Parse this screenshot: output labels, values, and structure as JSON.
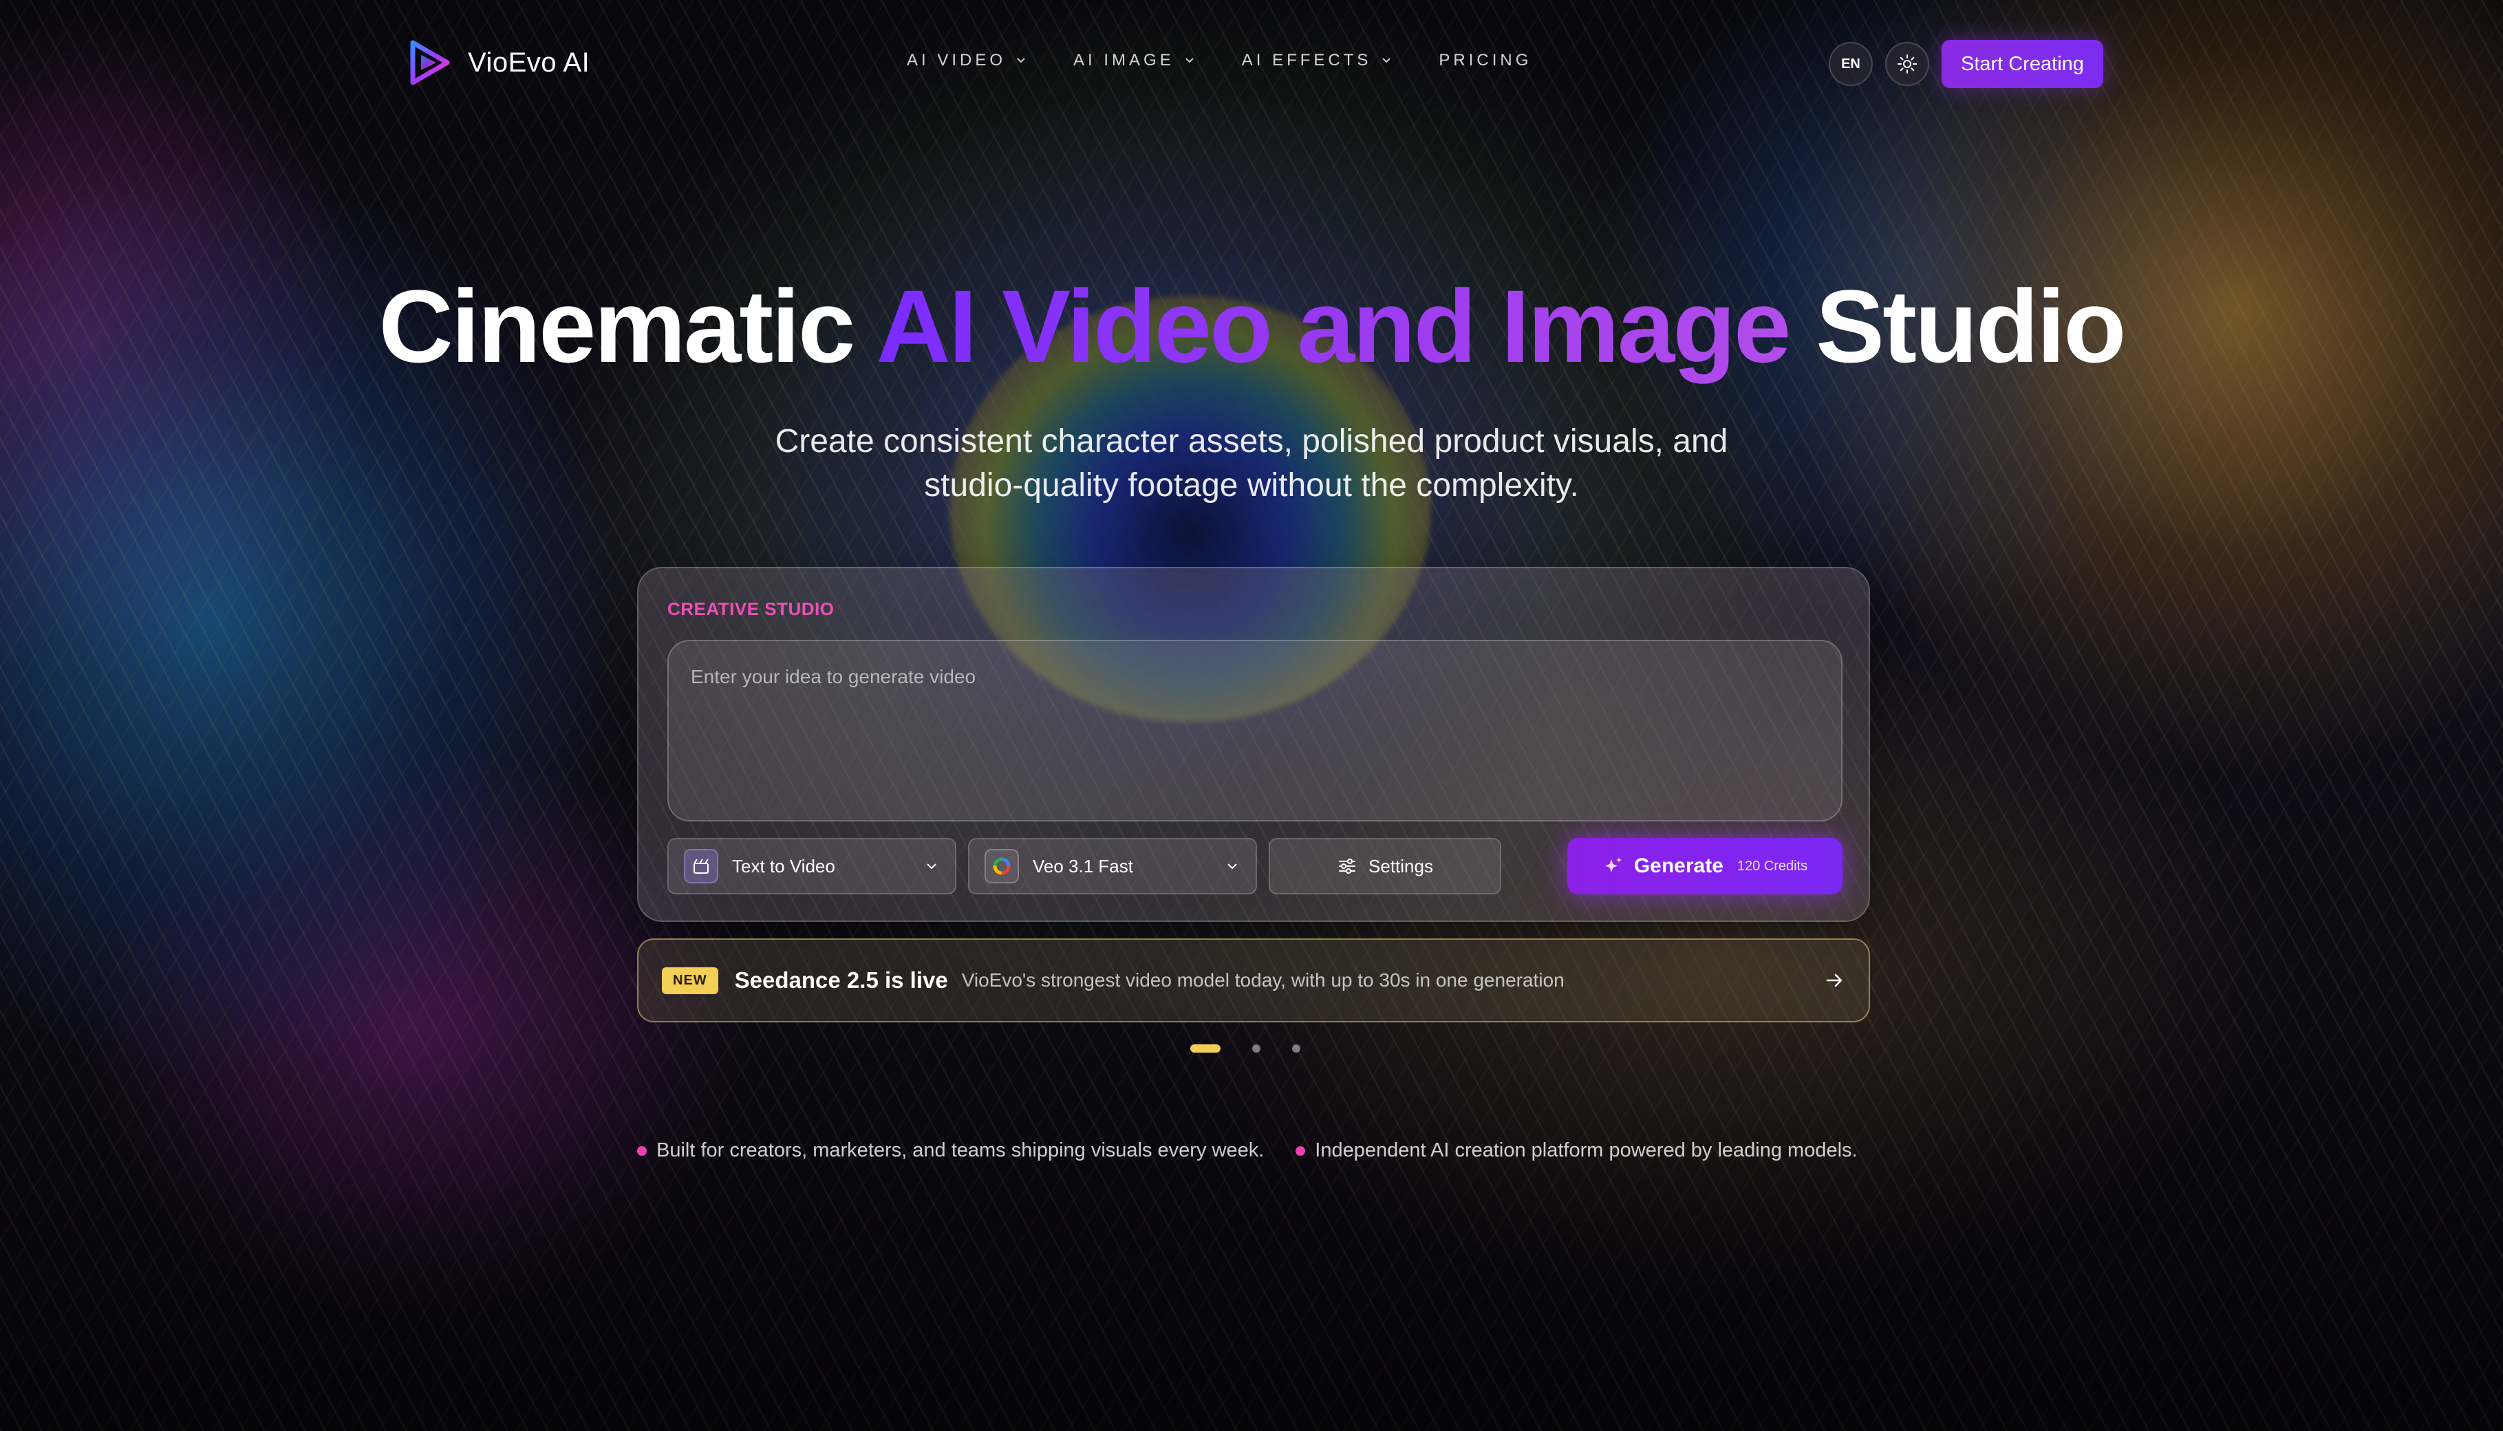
{
  "brand": {
    "name": "VioEvo AI"
  },
  "nav": {
    "items": [
      {
        "label": "AI VIDEO",
        "has_dropdown": true
      },
      {
        "label": "AI IMAGE",
        "has_dropdown": true
      },
      {
        "label": "AI EFFECTS",
        "has_dropdown": true
      },
      {
        "label": "PRICING",
        "has_dropdown": false
      }
    ],
    "language": "EN",
    "theme_icon": "sun-icon",
    "cta_label": "Start Creating"
  },
  "hero": {
    "title_part1": "Cinematic ",
    "title_highlight": "AI Video and Image",
    "title_part2": " Studio",
    "subtitle_line1": "Create consistent character assets, polished product visuals, and",
    "subtitle_line2": "studio-quality footage without the complexity."
  },
  "studio": {
    "label": "CREATIVE STUDIO",
    "prompt_placeholder": "Enter your idea to generate video",
    "mode_select": "Text to Video",
    "model_select": "Veo 3.1 Fast",
    "settings_label": "Settings",
    "generate_label": "Generate",
    "credits_label": "120 Credits"
  },
  "announcement": {
    "badge": "NEW",
    "title": "Seedance 2.5 is live",
    "description": "VioEvo's strongest video model today, with up to 30s in one generation"
  },
  "carousel": {
    "total": 3,
    "active_index": 0
  },
  "bullets": [
    "Built for creators, marketers, and teams shipping visuals every week.",
    "Independent AI creation platform powered by leading models."
  ],
  "colors": {
    "accent_purple": "#7b2cf0",
    "label_pink": "#ee4fb8",
    "badge_yellow": "#f4cf55"
  }
}
